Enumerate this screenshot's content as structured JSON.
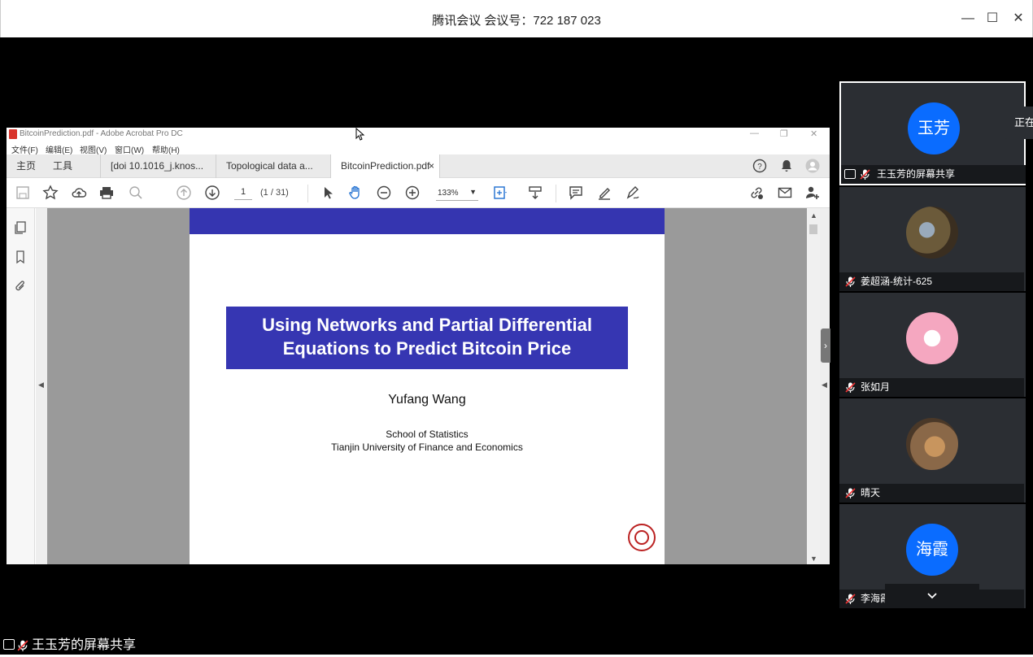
{
  "meeting": {
    "title": "腾讯会议 会议号：722 187 023",
    "minimize": "—",
    "maximize": "☐",
    "close": "✕"
  },
  "acrobat": {
    "window_title": "BitcoinPrediction.pdf - Adobe Acrobat Pro DC",
    "menu": [
      "文件(F)",
      "编辑(E)",
      "视图(V)",
      "窗口(W)",
      "帮助(H)"
    ],
    "tabs": {
      "home": "主页",
      "tools": "工具",
      "doc1": "[doi 10.1016_j.knos...",
      "doc2": "Topological data a...",
      "doc3": "BitcoinPrediction.pdf",
      "doc3_close": "×"
    },
    "page_current": "1",
    "page_count": "(1 / 31)",
    "zoom": "133%"
  },
  "pdf": {
    "title_line1": "Using Networks and Partial Differential",
    "title_line2": "Equations to Predict Bitcoin Price",
    "author": "Yufang Wang",
    "aff_line1": "School of Statistics",
    "aff_line2": "Tianjin University of Finance and Economics"
  },
  "participants": [
    {
      "name": "王玉芳的屏幕共享",
      "avatar_text": "玉芳",
      "avatar_color": "#0a6cff",
      "sharing": true
    },
    {
      "name": "姜超涵-统计-625",
      "avatar_text": "",
      "avatar_color": "#6b5a3a",
      "sharing": false
    },
    {
      "name": "张如月",
      "avatar_text": "",
      "avatar_color": "#f5a7c0",
      "sharing": false
    },
    {
      "name": "晴天",
      "avatar_text": "",
      "avatar_color": "#8a6848",
      "sharing": false
    },
    {
      "name": "李海霞",
      "avatar_text": "海霞",
      "avatar_color": "#0a6cff",
      "sharing": false
    }
  ],
  "tooltip_text": "正在",
  "sharer_label": "王玉芳的屏幕共享",
  "colors": {
    "accent": "#0a6cff",
    "pdf_blue": "#3636b2"
  }
}
